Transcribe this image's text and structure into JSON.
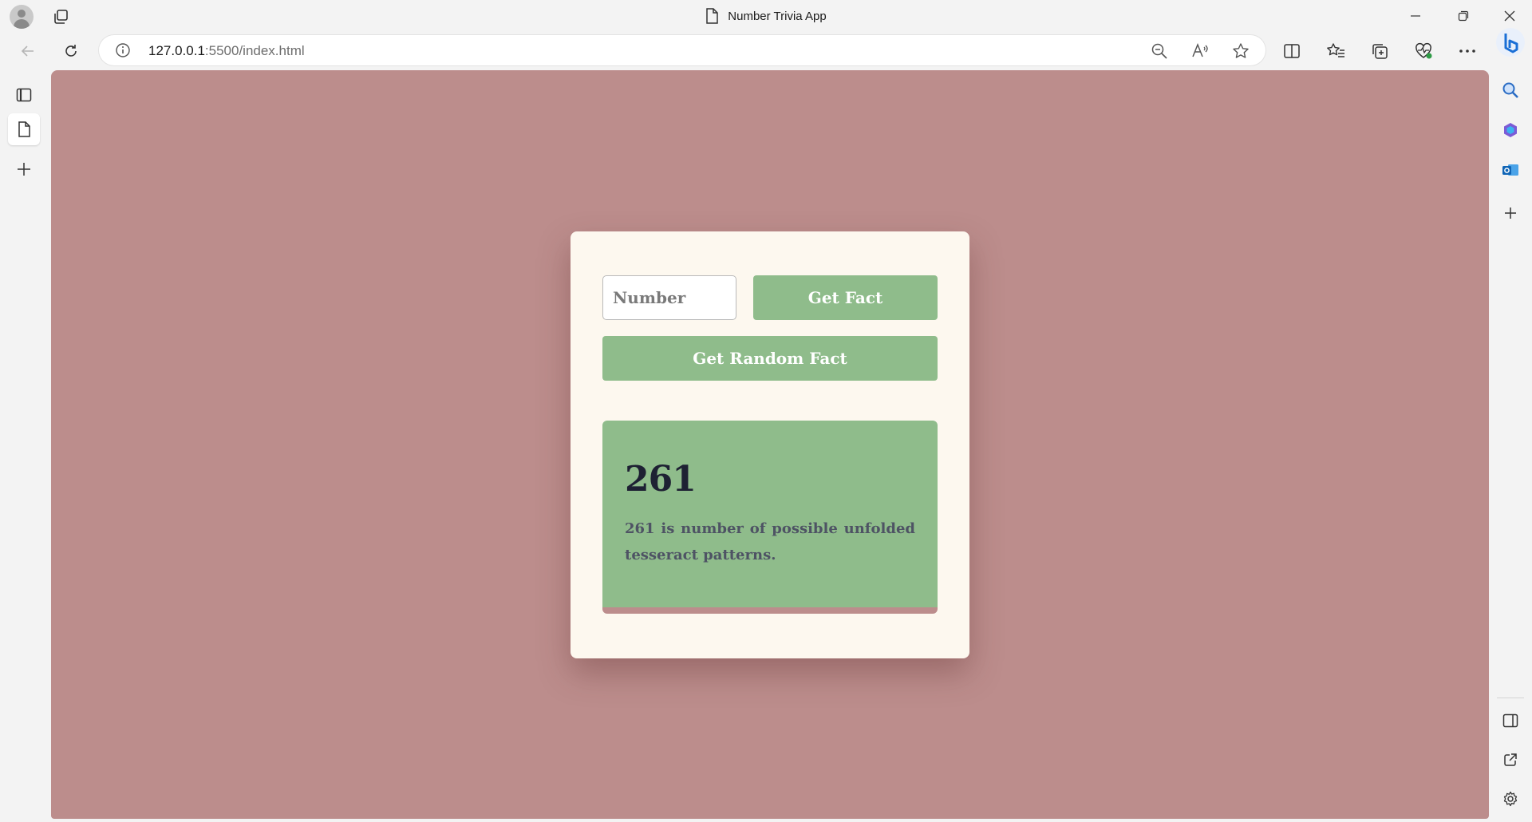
{
  "window": {
    "title": "Number Trivia App",
    "controls": [
      "minimize-icon",
      "restore-icon",
      "close-icon"
    ]
  },
  "browser": {
    "url_host": "127.0.0.1",
    "url_path": ":5500/index.html",
    "toolbar_icons": [
      "back-icon",
      "refresh-icon",
      "zoom-out-icon",
      "read-aloud-icon",
      "favorite-star-icon",
      "split-screen-icon",
      "favorites-icon",
      "collections-icon",
      "browser-essentials-icon",
      "more-icon",
      "copilot-icon"
    ],
    "left_sidebar_icons": [
      "tab-actions-icon",
      "page-icon",
      "new-tab-icon"
    ],
    "right_sidebar_icons": [
      "search-icon",
      "office-icon",
      "outlook-icon",
      "add-icon",
      "sidebar-layout-icon",
      "external-link-icon",
      "settings-icon"
    ]
  },
  "app": {
    "number_input": {
      "placeholder": "Number",
      "value": ""
    },
    "get_fact_label": "Get Fact",
    "get_random_label": "Get Random Fact",
    "result": {
      "number": "261",
      "fact": "261 is number of possible unfolded tesseract patterns."
    }
  },
  "colors": {
    "page_background": "#bc8d8c",
    "card_background": "#fdf8ef",
    "accent_green": "#8fbc8b",
    "result_number": "#1e2133",
    "result_text": "#4e5364"
  }
}
